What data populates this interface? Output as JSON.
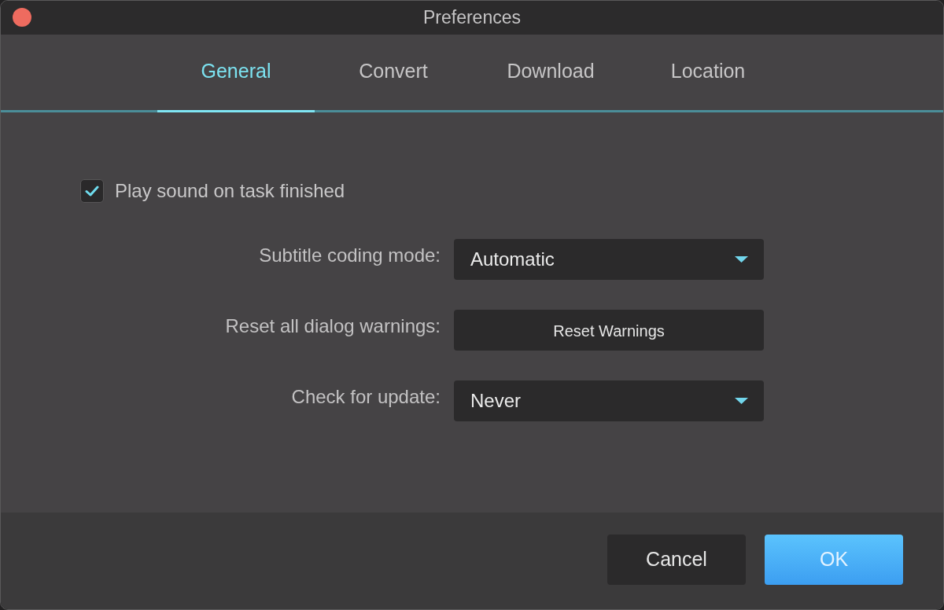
{
  "window": {
    "title": "Preferences"
  },
  "tabs": [
    {
      "label": "General",
      "selected": true
    },
    {
      "label": "Convert",
      "selected": false
    },
    {
      "label": "Download",
      "selected": false
    },
    {
      "label": "Location",
      "selected": false
    }
  ],
  "options": [
    {
      "kind": "checkbox",
      "label": "Play sound on task finished",
      "checked": true
    },
    {
      "kind": "dropdown",
      "label": "Subtitle coding mode:",
      "value": "Automatic"
    },
    {
      "kind": "button",
      "label": "Reset all dialog warnings:",
      "button": "Reset Warnings"
    },
    {
      "kind": "dropdown",
      "label": "Check for update:",
      "value": "Never"
    }
  ],
  "buttons": [
    {
      "kind": "secondary",
      "label": "Cancel"
    },
    {
      "kind": "primary",
      "label": "OK"
    }
  ]
}
